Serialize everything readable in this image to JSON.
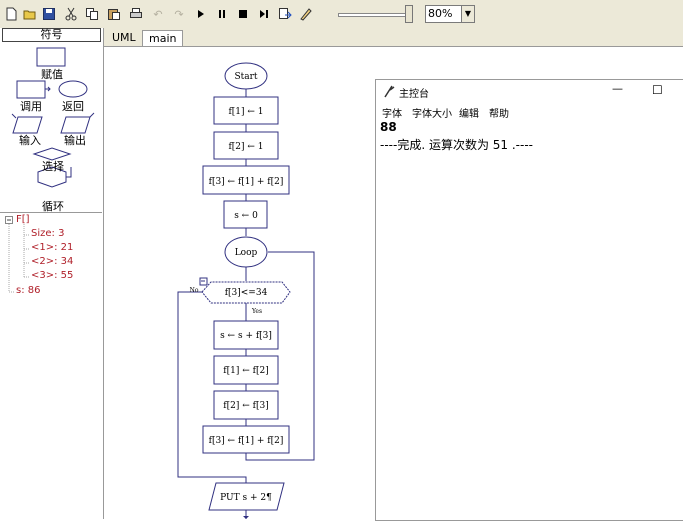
{
  "toolbar": {
    "buttons": [
      "new",
      "open",
      "save",
      "cut",
      "copy",
      "paste",
      "print",
      "undo",
      "redo",
      "run",
      "pause",
      "stop",
      "step",
      "export",
      "edit"
    ],
    "zoom": {
      "level_fraction": 0.95,
      "value": "80%"
    }
  },
  "left_panel": {
    "header": "符号",
    "symbols": {
      "assign": "赋值",
      "call": "调用",
      "return": "返回",
      "input": "输入",
      "output": "输出",
      "select": "选择",
      "loop": "循环"
    },
    "tree": {
      "root": "F[]",
      "items": [
        "Size: 3",
        "<1>: 21",
        "<2>: 34",
        "<3>: 55"
      ],
      "var_s": "s: 86"
    }
  },
  "tabs": [
    "UML",
    "main"
  ],
  "flowchart": {
    "start": "Start",
    "f1": "f[1] ← 1",
    "f2": "f[2] ← 1",
    "f3": "f[3] ← f[1] + f[2]",
    "s0": "s ← 0",
    "loop": "Loop",
    "cond": "f[3]<=34",
    "no": "No",
    "yes": "Yes",
    "b1": "s ← s + f[3]",
    "b2": "f[1] ← f[2]",
    "b3": "f[2] ← f[3]",
    "b4": "f[3] ← f[1] + f[2]",
    "put": "PUT s + 2¶"
  },
  "console": {
    "title": "主控台",
    "menu": [
      "字体",
      "字体大小",
      "编辑",
      "帮助"
    ],
    "lines": [
      "88",
      "----完成. 运算次数为  51 .----"
    ],
    "min_glyph": "—",
    "max_glyph": "☐"
  }
}
